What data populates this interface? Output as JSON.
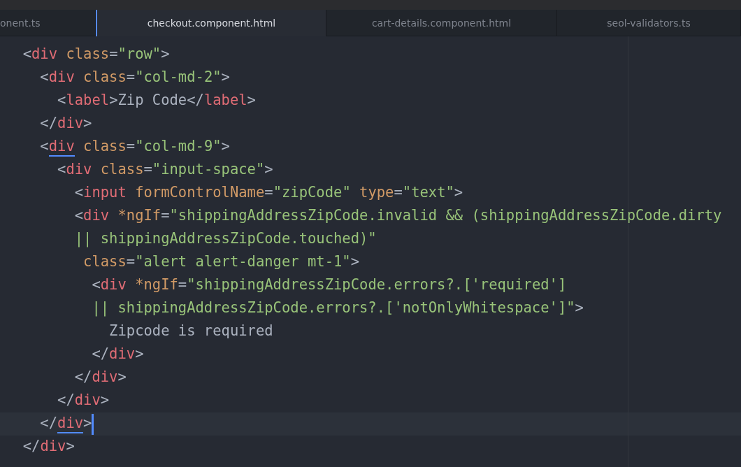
{
  "tabs": [
    {
      "label": "onent.ts",
      "selected": false
    },
    {
      "label": "checkout.component.html",
      "selected": true
    },
    {
      "label": "cart-details.component.html",
      "selected": false
    },
    {
      "label": "seol-validators.ts",
      "selected": false
    }
  ],
  "code_lines": [
    {
      "current": false,
      "segments": [
        {
          "kind": "punct",
          "text": "  <"
        },
        {
          "kind": "tag",
          "text": "div"
        },
        {
          "kind": "attr",
          "text": " class"
        },
        {
          "kind": "punct",
          "text": "="
        },
        {
          "kind": "string",
          "text": "\"row\""
        },
        {
          "kind": "punct",
          "text": ">"
        }
      ]
    },
    {
      "current": false,
      "segments": [
        {
          "kind": "punct",
          "text": "    <"
        },
        {
          "kind": "tag",
          "text": "div"
        },
        {
          "kind": "attr",
          "text": " class"
        },
        {
          "kind": "punct",
          "text": "="
        },
        {
          "kind": "string",
          "text": "\"col-md-2\""
        },
        {
          "kind": "punct",
          "text": ">"
        }
      ]
    },
    {
      "current": false,
      "segments": [
        {
          "kind": "punct",
          "text": "      <"
        },
        {
          "kind": "tag",
          "text": "label"
        },
        {
          "kind": "punct",
          "text": ">Zip Code</"
        },
        {
          "kind": "tag",
          "text": "label"
        },
        {
          "kind": "punct",
          "text": ">"
        }
      ]
    },
    {
      "current": false,
      "segments": [
        {
          "kind": "punct",
          "text": "    </"
        },
        {
          "kind": "tag",
          "text": "div"
        },
        {
          "kind": "punct",
          "text": ">"
        }
      ]
    },
    {
      "current": false,
      "segments": [
        {
          "kind": "punct",
          "text": "    <"
        },
        {
          "kind": "tag",
          "text": "div",
          "matched": true
        },
        {
          "kind": "attr",
          "text": " class"
        },
        {
          "kind": "punct",
          "text": "="
        },
        {
          "kind": "string",
          "text": "\"col-md-9\""
        },
        {
          "kind": "punct",
          "text": ">"
        }
      ]
    },
    {
      "current": false,
      "segments": [
        {
          "kind": "punct",
          "text": "      <"
        },
        {
          "kind": "tag",
          "text": "div"
        },
        {
          "kind": "attr",
          "text": " class"
        },
        {
          "kind": "punct",
          "text": "="
        },
        {
          "kind": "string",
          "text": "\"input-space\""
        },
        {
          "kind": "punct",
          "text": ">"
        }
      ]
    },
    {
      "current": false,
      "segments": [
        {
          "kind": "punct",
          "text": "        <"
        },
        {
          "kind": "tag",
          "text": "input"
        },
        {
          "kind": "attr",
          "text": " formControlName"
        },
        {
          "kind": "punct",
          "text": "="
        },
        {
          "kind": "string",
          "text": "\"zipCode\""
        },
        {
          "kind": "attr",
          "text": " type"
        },
        {
          "kind": "punct",
          "text": "="
        },
        {
          "kind": "string",
          "text": "\"text\""
        },
        {
          "kind": "punct",
          "text": ">"
        }
      ]
    },
    {
      "current": false,
      "segments": [
        {
          "kind": "punct",
          "text": "        <"
        },
        {
          "kind": "tag",
          "text": "div"
        },
        {
          "kind": "attr",
          "text": " *ngIf"
        },
        {
          "kind": "punct",
          "text": "="
        },
        {
          "kind": "string",
          "text": "\"shippingAddressZipCode.invalid && (shippingAddressZipCode.dirty"
        }
      ]
    },
    {
      "current": false,
      "segments": [
        {
          "kind": "string",
          "text": "        || shippingAddressZipCode.touched)\""
        }
      ]
    },
    {
      "current": false,
      "segments": [
        {
          "kind": "attr",
          "text": "         class"
        },
        {
          "kind": "punct",
          "text": "="
        },
        {
          "kind": "string",
          "text": "\"alert alert-danger mt-1\""
        },
        {
          "kind": "punct",
          "text": ">"
        }
      ]
    },
    {
      "current": false,
      "segments": [
        {
          "kind": "punct",
          "text": "          <"
        },
        {
          "kind": "tag",
          "text": "div"
        },
        {
          "kind": "attr",
          "text": " *ngIf"
        },
        {
          "kind": "punct",
          "text": "="
        },
        {
          "kind": "string",
          "text": "\"shippingAddressZipCode.errors?.['required']"
        }
      ]
    },
    {
      "current": false,
      "segments": [
        {
          "kind": "string",
          "text": "          || shippingAddressZipCode.errors?.['notOnlyWhitespace']\""
        },
        {
          "kind": "punct",
          "text": ">"
        }
      ]
    },
    {
      "current": false,
      "segments": [
        {
          "kind": "punct",
          "text": "            Zipcode is required"
        }
      ]
    },
    {
      "current": false,
      "segments": [
        {
          "kind": "punct",
          "text": "          </"
        },
        {
          "kind": "tag",
          "text": "div"
        },
        {
          "kind": "punct",
          "text": ">"
        }
      ]
    },
    {
      "current": false,
      "segments": [
        {
          "kind": "punct",
          "text": "        </"
        },
        {
          "kind": "tag",
          "text": "div"
        },
        {
          "kind": "punct",
          "text": ">"
        }
      ]
    },
    {
      "current": false,
      "segments": [
        {
          "kind": "punct",
          "text": "      </"
        },
        {
          "kind": "tag",
          "text": "div"
        },
        {
          "kind": "punct",
          "text": ">"
        }
      ]
    },
    {
      "current": true,
      "segments": [
        {
          "kind": "punct",
          "text": "    </"
        },
        {
          "kind": "tag",
          "text": "div",
          "matched": true
        },
        {
          "kind": "punct",
          "text": ">"
        }
      ]
    },
    {
      "current": false,
      "segments": [
        {
          "kind": "punct",
          "text": "  </"
        },
        {
          "kind": "tag",
          "text": "div"
        },
        {
          "kind": "punct",
          "text": ">"
        }
      ]
    }
  ]
}
